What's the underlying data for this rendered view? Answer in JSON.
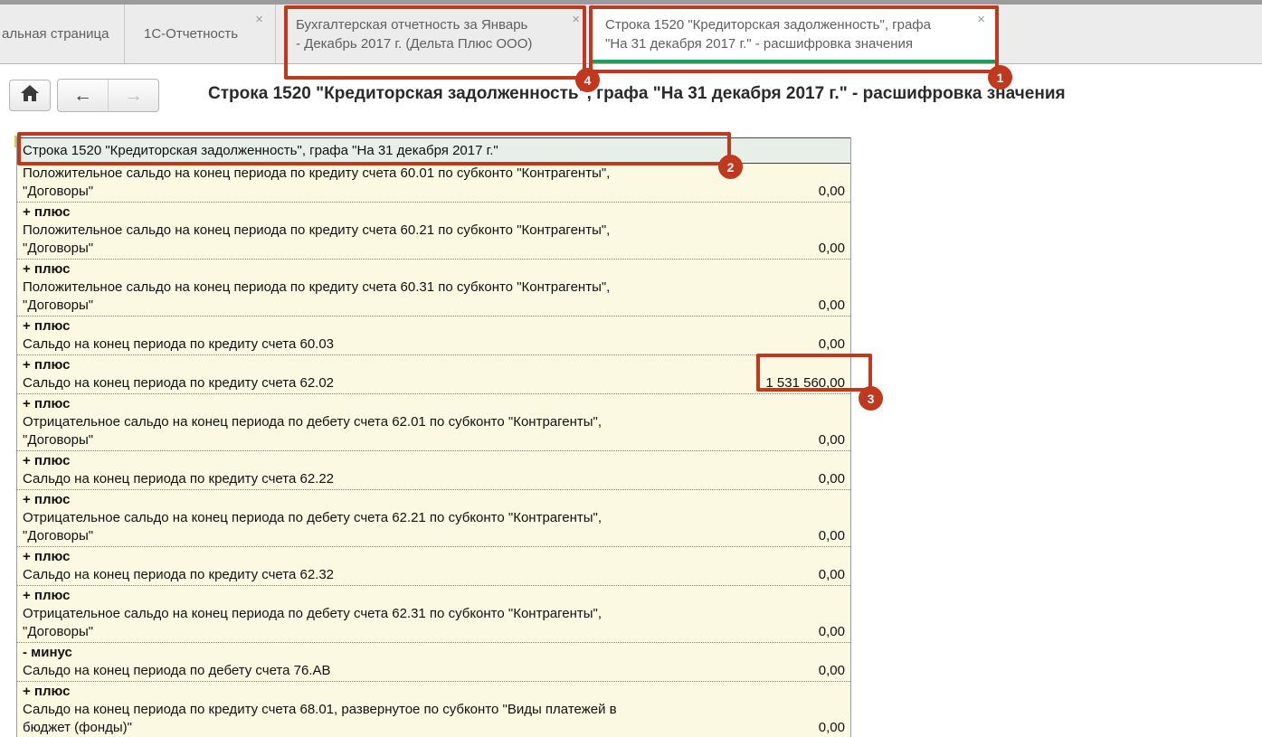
{
  "icons": {
    "close": "×",
    "back": "←",
    "forward": "→",
    "home": "⌂"
  },
  "colors": {
    "active_tab_underline": "#18a15b",
    "annotation_red": "#c0391e",
    "table_header_bg": "#e7efe8",
    "table_body_bg": "#fcf9e2"
  },
  "tabs": [
    {
      "lines": [
        "альная страница"
      ],
      "closable": false,
      "active": false
    },
    {
      "lines": [
        "1С-Отчетность"
      ],
      "closable": true,
      "active": false
    },
    {
      "lines": [
        "Бухгалтерская отчетность за Январь",
        "- Декабрь 2017 г. (Дельта Плюс ООО)"
      ],
      "closable": true,
      "active": false
    },
    {
      "lines": [
        "Строка 1520 \"Кредиторская задолженность\", графа",
        "\"На 31 декабря 2017 г.\" - расшифровка значения"
      ],
      "closable": true,
      "active": true
    }
  ],
  "page_title": "Строка 1520 \"Кредиторская задолженность\", графа \"На 31 декабря 2017 г.\" - расшифровка значения",
  "table": {
    "header": "Строка 1520 \"Кредиторская задолженность\", графа \"На 31 декабря 2017 г.\"",
    "rows": [
      {
        "op": "",
        "lines": [
          "Положительное сальдо на конец периода по кредиту счета 60.01 по субконто \"Контрагенты\",",
          "\"Договоры\""
        ],
        "value": "0,00"
      },
      {
        "op": "+ плюс",
        "lines": [
          "Положительное сальдо на конец периода по кредиту счета 60.21 по субконто \"Контрагенты\",",
          "\"Договоры\""
        ],
        "value": "0,00"
      },
      {
        "op": "+ плюс",
        "lines": [
          "Положительное сальдо на конец периода по кредиту счета 60.31 по субконто \"Контрагенты\",",
          "\"Договоры\""
        ],
        "value": "0,00"
      },
      {
        "op": "+ плюс",
        "lines": [
          "Сальдо на конец периода по кредиту счета 60.03"
        ],
        "value": "0,00"
      },
      {
        "op": "+ плюс",
        "lines": [
          "Сальдо на конец периода по кредиту счета 62.02"
        ],
        "value": "1 531 560,00"
      },
      {
        "op": "+ плюс",
        "lines": [
          "Отрицательное сальдо на конец периода по дебету счета 62.01 по субконто \"Контрагенты\",",
          "\"Договоры\""
        ],
        "value": "0,00"
      },
      {
        "op": "+ плюс",
        "lines": [
          "Сальдо на конец периода по кредиту счета 62.22"
        ],
        "value": "0,00"
      },
      {
        "op": "+ плюс",
        "lines": [
          "Отрицательное сальдо на конец периода по дебету счета 62.21 по субконто \"Контрагенты\",",
          "\"Договоры\""
        ],
        "value": "0,00"
      },
      {
        "op": "+ плюс",
        "lines": [
          "Сальдо на конец периода по кредиту счета 62.32"
        ],
        "value": "0,00"
      },
      {
        "op": "+ плюс",
        "lines": [
          "Отрицательное сальдо на конец периода по дебету счета 62.31 по субконто \"Контрагенты\",",
          "\"Договоры\""
        ],
        "value": "0,00"
      },
      {
        "op": "- минус",
        "lines": [
          "Сальдо на конец периода по дебету счета 76.АВ"
        ],
        "value": "0,00"
      },
      {
        "op": "+ плюс",
        "lines": [
          "Сальдо на конец периода по кредиту счета 68.01, развернутое по субконто \"Виды платежей в",
          "бюджет (фонды)\""
        ],
        "value": "0,00"
      }
    ]
  },
  "annotations": {
    "badges": [
      "1",
      "2",
      "3",
      "4"
    ]
  }
}
